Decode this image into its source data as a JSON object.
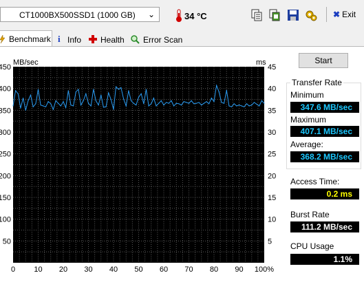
{
  "toolbar": {
    "drive": "CT1000BX500SSD1 (1000 GB)",
    "temperature": "34 °C",
    "exit_label": "Exit"
  },
  "tabs": [
    {
      "label": "Benchmark",
      "icon": "benchmark-icon",
      "active": true
    },
    {
      "label": "Info",
      "icon": "info-icon"
    },
    {
      "label": "Health",
      "icon": "health-cross-icon"
    },
    {
      "label": "Error Scan",
      "icon": "magnifier-icon"
    }
  ],
  "chart": {
    "left_unit": "MB/sec",
    "right_unit": "ms",
    "left_ticks": [
      "450",
      "400",
      "350",
      "300",
      "250",
      "200",
      "150",
      "100",
      "50"
    ],
    "right_ticks": [
      "45",
      "40",
      "35",
      "30",
      "25",
      "20",
      "15",
      "10",
      "5"
    ],
    "x_ticks": [
      "0",
      "10",
      "20",
      "30",
      "40",
      "50",
      "60",
      "70",
      "80",
      "90",
      "100%"
    ]
  },
  "chart_data": {
    "type": "line",
    "xlabel": "",
    "ylabel": "MB/sec",
    "xlim": [
      0,
      100
    ],
    "ylim": [
      0,
      450
    ],
    "series": [
      {
        "color": "#2a9df4",
        "x": [
          0,
          1,
          2,
          3,
          4,
          5,
          6,
          7,
          8,
          9,
          10,
          11,
          12,
          13,
          14,
          15,
          16,
          17,
          18,
          19,
          20,
          21,
          22,
          23,
          24,
          25,
          26,
          27,
          28,
          29,
          30,
          31,
          32,
          33,
          34,
          35,
          36,
          37,
          38,
          39,
          40,
          41,
          42,
          43,
          44,
          45,
          46,
          47,
          48,
          49,
          50,
          51,
          52,
          53,
          54,
          55,
          56,
          57,
          58,
          59,
          60,
          61,
          62,
          63,
          64,
          65,
          66,
          67,
          68,
          69,
          70,
          71,
          72,
          73,
          74,
          75,
          76,
          77,
          78,
          79,
          80,
          81,
          82,
          83,
          84,
          85,
          86,
          87,
          88,
          89,
          90,
          91,
          92,
          93,
          94,
          95,
          96,
          97,
          98,
          99,
          100
        ],
        "y": [
          360,
          395,
          388,
          355,
          378,
          350,
          372,
          385,
          358,
          365,
          398,
          362,
          360,
          358,
          370,
          365,
          352,
          372,
          366,
          360,
          370,
          356,
          395,
          362,
          360,
          392,
          398,
          362,
          372,
          388,
          366,
          360,
          398,
          372,
          362,
          385,
          357,
          358,
          390,
          375,
          352,
          404,
          398,
          402,
          376,
          360,
          395,
          372,
          366,
          362,
          380,
          388,
          365,
          398,
          360,
          365,
          378,
          360,
          366,
          372,
          362,
          368,
          366,
          372,
          360,
          366,
          365,
          362,
          370,
          368,
          366,
          372,
          365,
          366,
          368,
          362,
          366,
          370,
          365,
          378,
          370,
          407,
          392,
          368,
          366,
          396,
          360,
          358,
          365,
          360,
          362,
          360,
          358,
          365,
          360,
          362,
          368,
          364,
          360,
          372,
          366
        ]
      }
    ]
  },
  "controls": {
    "start_label": "Start"
  },
  "stats": {
    "transfer_rate_title": "Transfer Rate",
    "minimum_label": "Minimum",
    "minimum_value": "347.6 MB/sec",
    "maximum_label": "Maximum",
    "maximum_value": "407.1 MB/sec",
    "average_label": "Average:",
    "average_value": "368.2 MB/sec",
    "access_time_label": "Access Time:",
    "access_time_value": "0.2 ms",
    "burst_rate_label": "Burst Rate",
    "burst_rate_value": "111.2 MB/sec",
    "cpu_usage_label": "CPU Usage",
    "cpu_usage_value": "1.1%"
  }
}
